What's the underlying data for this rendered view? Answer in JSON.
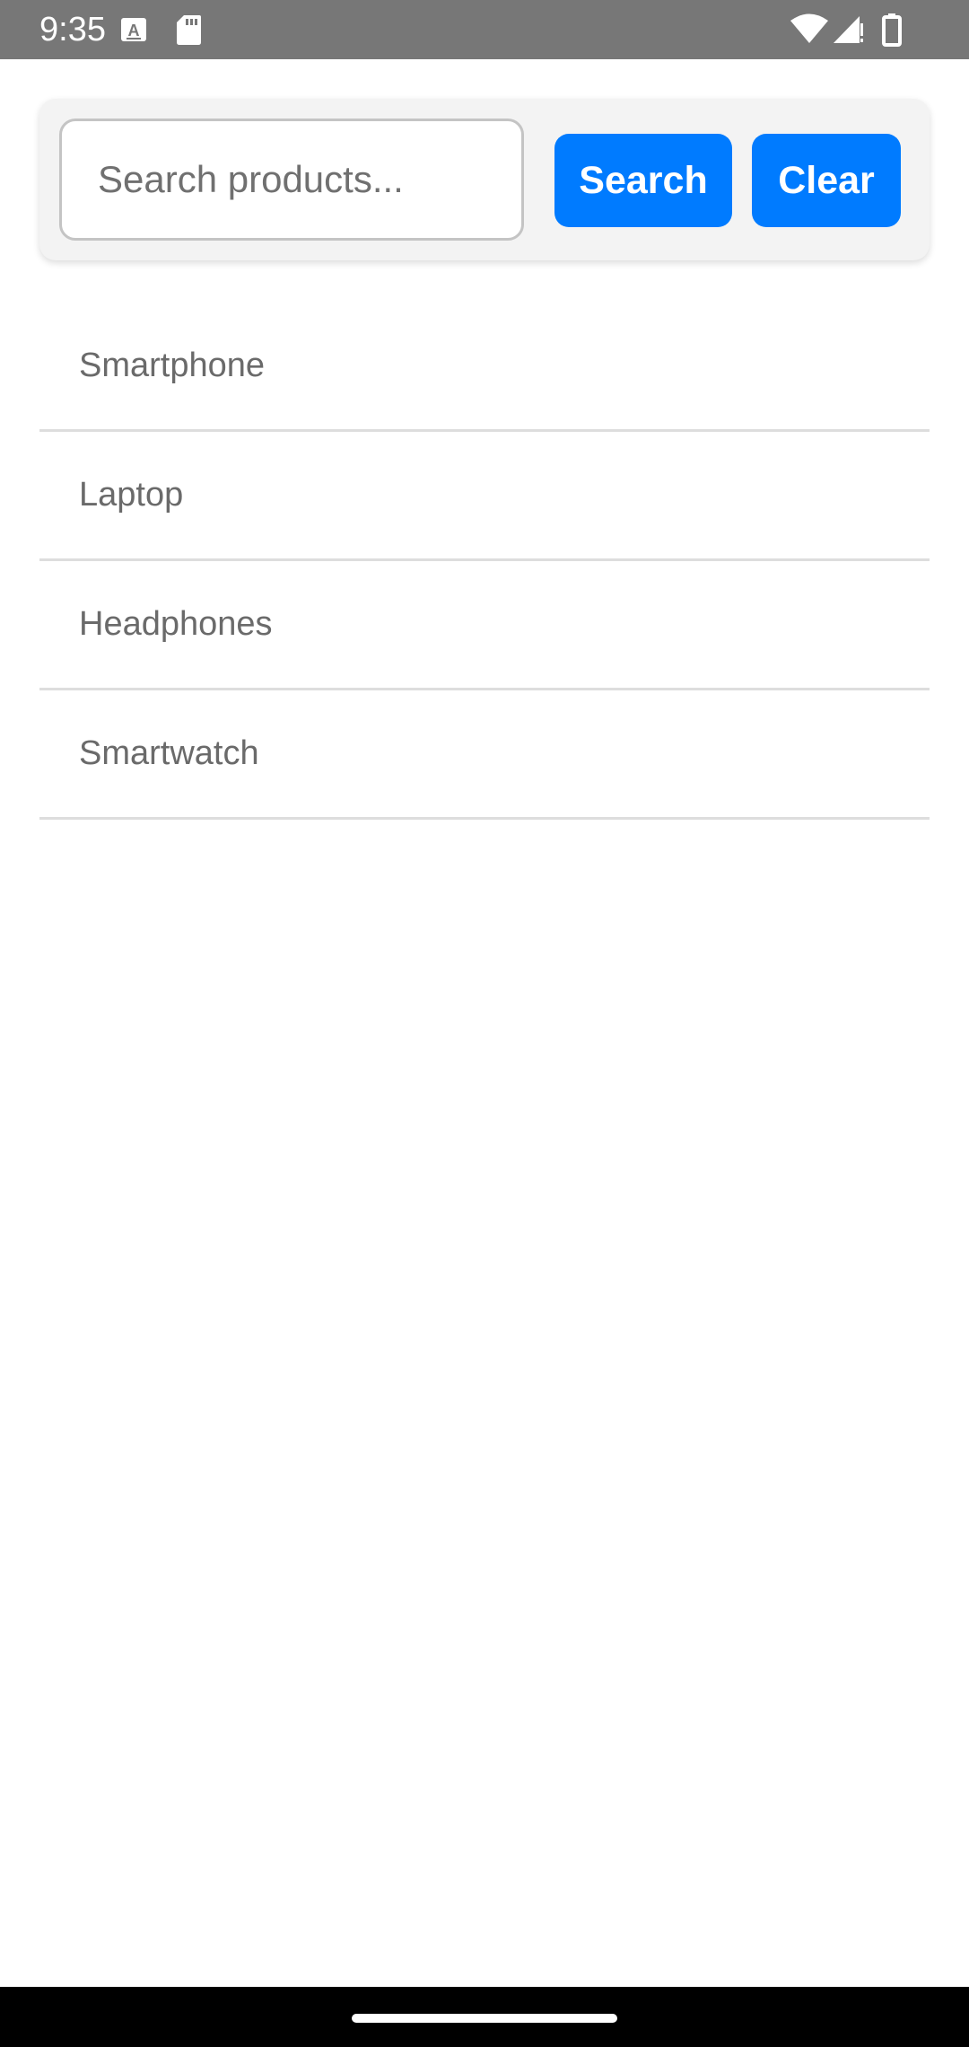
{
  "status_bar": {
    "time": "9:35",
    "icons": [
      "font-notification-icon",
      "sd-card-icon",
      "wifi-icon",
      "cell-signal-icon",
      "battery-icon"
    ],
    "background": "#777777"
  },
  "search": {
    "placeholder": "Search products...",
    "value": "",
    "search_button_label": "Search",
    "clear_button_label": "Clear",
    "accent_color": "#007bff"
  },
  "products": [
    {
      "name": "Smartphone"
    },
    {
      "name": "Laptop"
    },
    {
      "name": "Headphones"
    },
    {
      "name": "Smartwatch"
    }
  ]
}
